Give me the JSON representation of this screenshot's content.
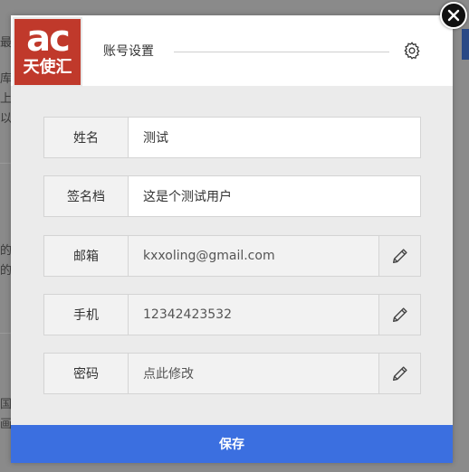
{
  "background": {
    "fragments": [
      "最新",
      "库孝",
      "上力",
      "以模",
      "的",
      "的",
      "国",
      "画具"
    ]
  },
  "header": {
    "logo_ac": "ac",
    "logo_text": "天使汇",
    "title": "账号设置"
  },
  "form": {
    "rows": [
      {
        "label": "姓名",
        "value": "测试",
        "editable": false
      },
      {
        "label": "签名档",
        "value": "这是个测试用户",
        "editable": false
      },
      {
        "label": "邮箱",
        "value": "kxxoling@gmail.com",
        "editable": true
      },
      {
        "label": "手机",
        "value": "12342423532",
        "editable": true
      },
      {
        "label": "密码",
        "value": "点此修改",
        "editable": true
      }
    ]
  },
  "footer": {
    "save_label": "保存"
  },
  "colors": {
    "accent": "#3b6fe0",
    "link": "#3b6fd6",
    "logo": "#c0392b"
  }
}
